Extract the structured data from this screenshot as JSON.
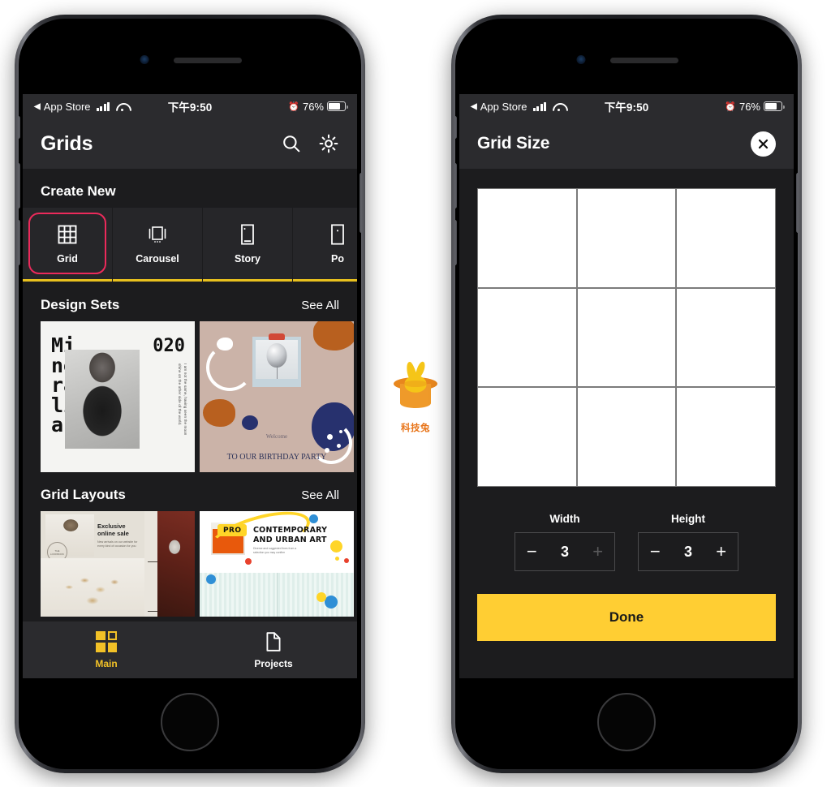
{
  "status_bar": {
    "back_arrow": "◀",
    "carrier_label": "App Store",
    "signal_icon": "signal-bars-icon",
    "wifi_icon": "wifi-icon",
    "time": "下午9:50",
    "alarm_icon": "⏰",
    "battery_percent": "76%",
    "battery_icon": "battery-icon"
  },
  "left_phone": {
    "nav": {
      "title": "Grids",
      "search_icon": "search-icon",
      "settings_icon": "gear-icon"
    },
    "create_new": {
      "title": "Create New",
      "items": [
        {
          "label": "Grid",
          "icon": "grid-icon",
          "selected": true
        },
        {
          "label": "Carousel",
          "icon": "carousel-icon",
          "selected": false
        },
        {
          "label": "Story",
          "icon": "story-icon",
          "selected": false
        },
        {
          "label": "Po",
          "icon": "post-icon",
          "selected": false
        }
      ],
      "selection_color": "#ec2a5b",
      "underline_color": "#e8c01e"
    },
    "design_sets": {
      "title": "Design Sets",
      "see_all": "See All",
      "cards": [
        {
          "name": "mineralia",
          "title_text": "Mi\nne\nra\nli\na",
          "number": "020",
          "vertical_text": "I am not the same, having seen the moon shine on the other side of the world."
        },
        {
          "name": "birthday-party",
          "welcome": "Welcome",
          "headline": "TO OUR BIRTHDAY PARTY"
        },
        {
          "name": "partial-card"
        }
      ]
    },
    "grid_layouts": {
      "title": "Grid Layouts",
      "see_all": "See All",
      "cards": [
        {
          "name": "exclusive-online-sale",
          "headline": "Exclusive\nonline sale",
          "subtext": "New arrivals on our website for every kind of occasion for you",
          "badge": "THE LOOKBOOK"
        },
        {
          "name": "contemporary-urban-art",
          "badge": "PRO",
          "headline": "CONTEMPORARY AND URBAN ART",
          "subtext": "Diverse and suggested lines from a selection you may confirm"
        },
        {
          "name": "partial-card"
        }
      ]
    },
    "tab_bar": {
      "tabs": [
        {
          "label": "Main",
          "icon": "grid-squares-icon",
          "active": true
        },
        {
          "label": "Projects",
          "icon": "document-icon",
          "active": false
        }
      ],
      "active_color": "#f2c127"
    }
  },
  "right_phone": {
    "nav": {
      "title": "Grid Size",
      "close_icon": "close-icon"
    },
    "grid_preview": {
      "columns": 3,
      "rows": 3,
      "cell_count": 9,
      "cell_color": "#ffffff",
      "divider_color": "#7b7b7b"
    },
    "steppers": [
      {
        "label": "Width",
        "value": "3",
        "minus": "−",
        "plus": "+",
        "plus_disabled": true
      },
      {
        "label": "Height",
        "value": "3",
        "minus": "−",
        "plus": "+",
        "plus_disabled": false
      }
    ],
    "done_button": {
      "label": "Done",
      "color": "#ffce33"
    }
  },
  "watermark": {
    "logo_icon": "rabbit-in-hat-icon",
    "text": "科技兔",
    "color": "#e8751a"
  }
}
